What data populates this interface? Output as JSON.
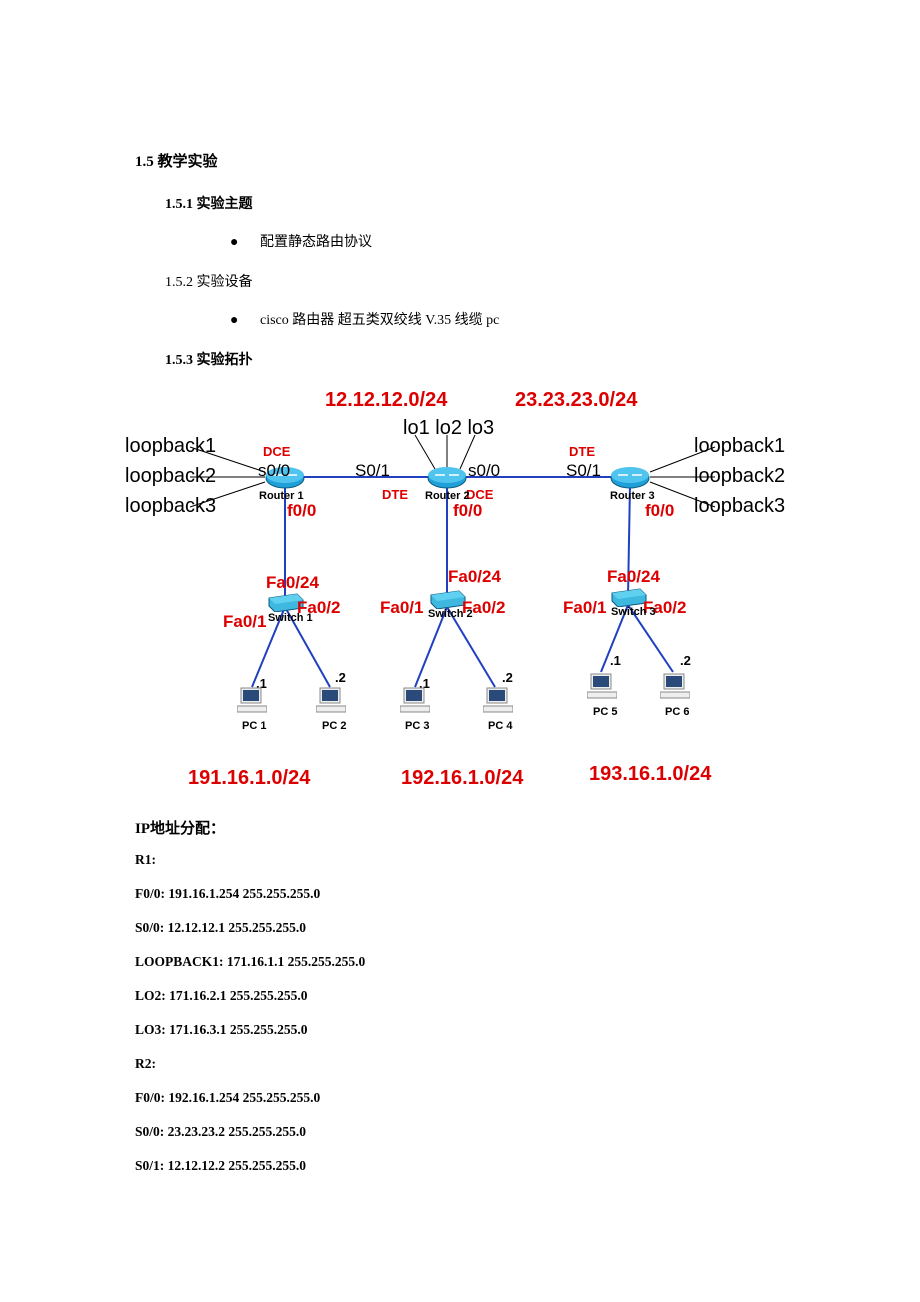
{
  "heading_main": "1.5 教学实验",
  "sec_151": "1.5.1 实验主题",
  "bullet_151": "配置静态路由协议",
  "sec_152": "1.5.2 实验设备",
  "bullet_152": "cisco 路由器 超五类双绞线  V.35 线缆  pc",
  "sec_153": "1.5.3 实验拓扑",
  "net": {
    "wan1": "12.12.12.0/24",
    "wan2": "23.23.23.0/24",
    "lo_top": "lo1 lo2 lo3",
    "loopback1": "loopback1",
    "loopback2": "loopback2",
    "loopback3": "loopback3",
    "DCE": "DCE",
    "DTE": "DTE",
    "s00": "s0/0",
    "S01": "S0/1",
    "f00": "f0/0",
    "Fa024": "Fa0/24",
    "Fa01": "Fa0/1",
    "Fa02": "Fa0/2",
    "Router1": "Router 1",
    "Router2": "Router 2",
    "Router3": "Router 3",
    "Switch1": "Switch 1",
    "Switch2": "Switch 2",
    "Switch3": "Switch 3",
    "dot1": ".1",
    "dot2": ".2",
    "PC1": "PC 1",
    "PC2": "PC 2",
    "PC3": "PC 3",
    "PC4": "PC 4",
    "PC5": "PC 5",
    "PC6": "PC 6",
    "lan1": "191.16.1.0/24",
    "lan2": "192.16.1.0/24",
    "lan3": "193.16.1.0/24"
  },
  "ip_title": "IP地址分配：",
  "R1": "R1:",
  "R1_f00": "F0/0:   191.16.1.254   255.255.255.0",
  "R1_s00": "S0/0:   12.12.12.1   255.255.255.0",
  "R1_lo1": "LOOPBACK1: 171.16.1.1   255.255.255.0",
  "R1_lo2": "LO2: 171.16.2.1   255.255.255.0",
  "R1_lo3": "LO3: 171.16.3.1   255.255.255.0",
  "R2": "R2:",
  "R2_f00": "F0/0:   192.16.1.254   255.255.255.0",
  "R2_s00": "S0/0:   23.23.23.2   255.255.255.0",
  "R2_s01": "S0/1:   12.12.12.2   255.255.255.0"
}
